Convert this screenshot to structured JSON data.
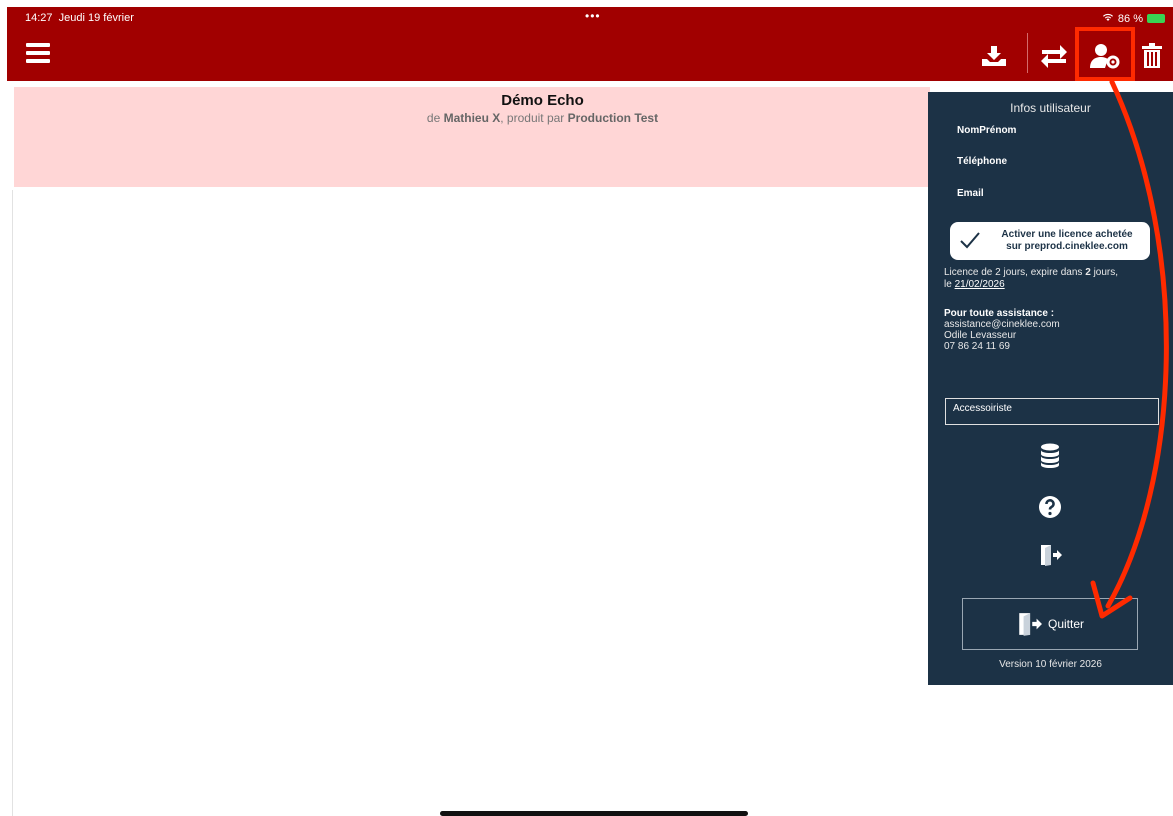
{
  "status": {
    "time": "14:27",
    "date": "Jeudi 19 février",
    "dots": "•••",
    "battery": "86 %"
  },
  "project": {
    "title": "Démo Echo",
    "sub_de": "de",
    "director": "Mathieu X",
    "sub_sep": ", produit par",
    "producer": "Production Test"
  },
  "panel": {
    "title": "Infos utilisateur",
    "field_name": "NomPrénom",
    "field_phone": "Téléphone",
    "field_email": "Email",
    "license_button_line1": "Activer une licence achetée",
    "license_button_line2": "sur preprod.cineklee.com",
    "license_a": "Licence de",
    "license_days": "2",
    "license_b": "jours, expire dans",
    "license_remaining": "2",
    "license_c": "jours,",
    "license_le": "le",
    "license_date": "21/02/2026",
    "assist_heading": "Pour toute assistance :",
    "assist_email": "assistance@cineklee.com",
    "assist_name": "Odile Levasseur",
    "assist_phone": "07 86 24 11 69",
    "role": "Accessoiriste",
    "quit_label": "Quitter",
    "version": "Version 10 février 2026"
  },
  "colors": {
    "toolbar": "#a10000",
    "header": "#ffd6d6",
    "panel": "#1c3246",
    "annotation": "#ff2a00"
  },
  "icons": {
    "menu": "hamburger-icon",
    "download": "download-tray-icon",
    "sync": "swap-arrows-icon",
    "user_settings": "user-settings-icon",
    "trash": "trash-icon",
    "database": "database-icon",
    "help": "help-icon",
    "logout": "exit-door-icon"
  }
}
